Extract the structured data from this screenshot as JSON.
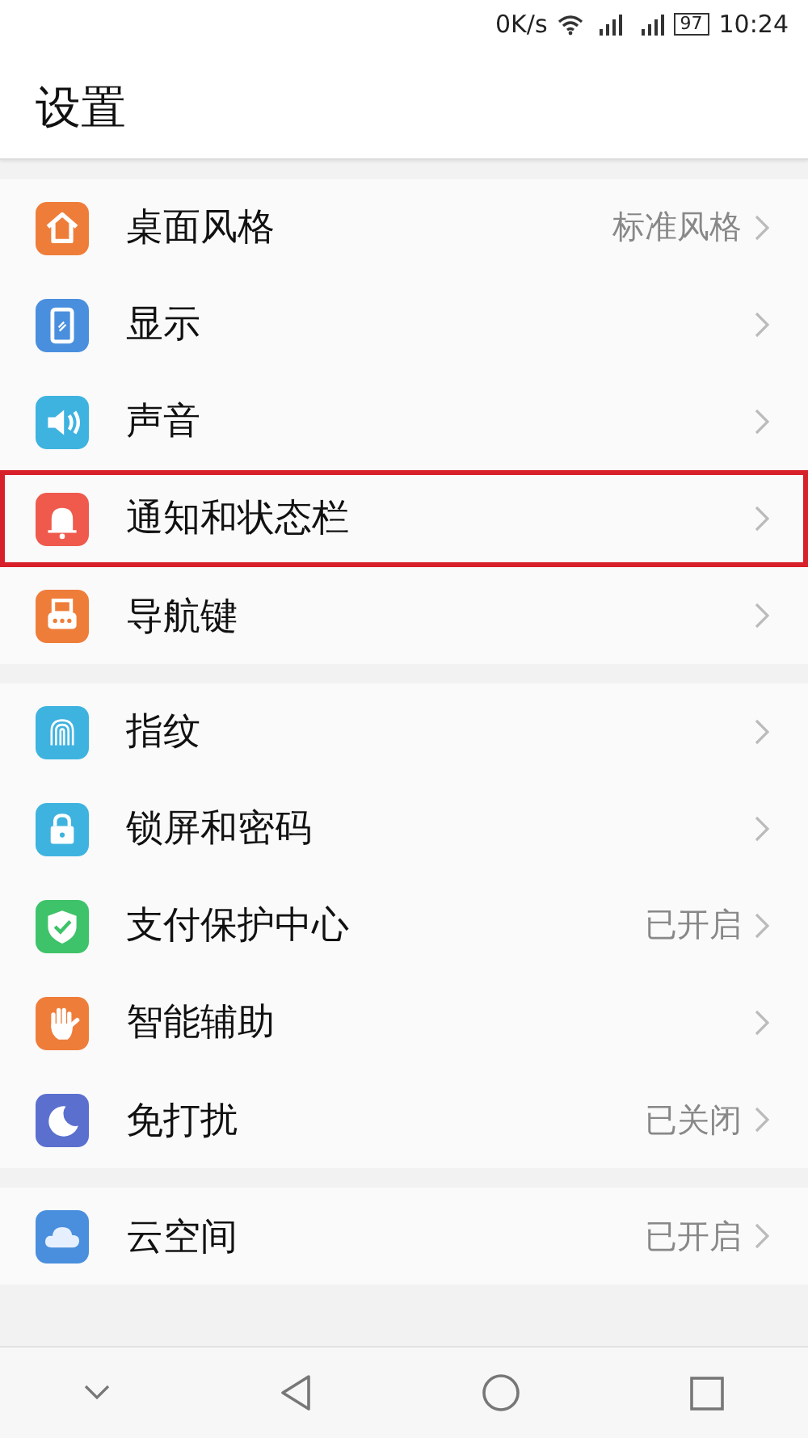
{
  "status_bar": {
    "speed": "0K/s",
    "battery": "97",
    "time": "10:24"
  },
  "header": {
    "title": "设置"
  },
  "groups": [
    {
      "items": [
        {
          "kind": "house",
          "color": "#ef7d3a",
          "label": "桌面风格",
          "value": "标准风格",
          "highlighted": false
        },
        {
          "kind": "phone",
          "color": "#4a8fde",
          "label": "显示",
          "highlighted": false
        },
        {
          "kind": "speaker",
          "color": "#3fb3e0",
          "label": "声音",
          "highlighted": false
        },
        {
          "kind": "bell",
          "color": "#ef5a4c",
          "label": "通知和状态栏",
          "highlighted": true
        },
        {
          "kind": "nav",
          "color": "#ef7d3a",
          "label": "导航键",
          "highlighted": false
        }
      ]
    },
    {
      "items": [
        {
          "kind": "fingerprint",
          "color": "#3fb3e0",
          "label": "指纹",
          "highlighted": false
        },
        {
          "kind": "lock",
          "color": "#3fb3e0",
          "label": "锁屏和密码",
          "highlighted": false
        },
        {
          "kind": "shield",
          "color": "#3fc36a",
          "label": "支付保护中心",
          "value": "已开启",
          "highlighted": false
        },
        {
          "kind": "hand",
          "color": "#ef7d3a",
          "label": "智能辅助",
          "highlighted": false
        },
        {
          "kind": "moon",
          "color": "#5b6fcf",
          "label": "免打扰",
          "value": "已关闭",
          "highlighted": false
        }
      ]
    },
    {
      "items": [
        {
          "kind": "cloud",
          "color": "#4a8fde",
          "label": "云空间",
          "value": "已开启",
          "highlighted": false
        }
      ]
    }
  ]
}
